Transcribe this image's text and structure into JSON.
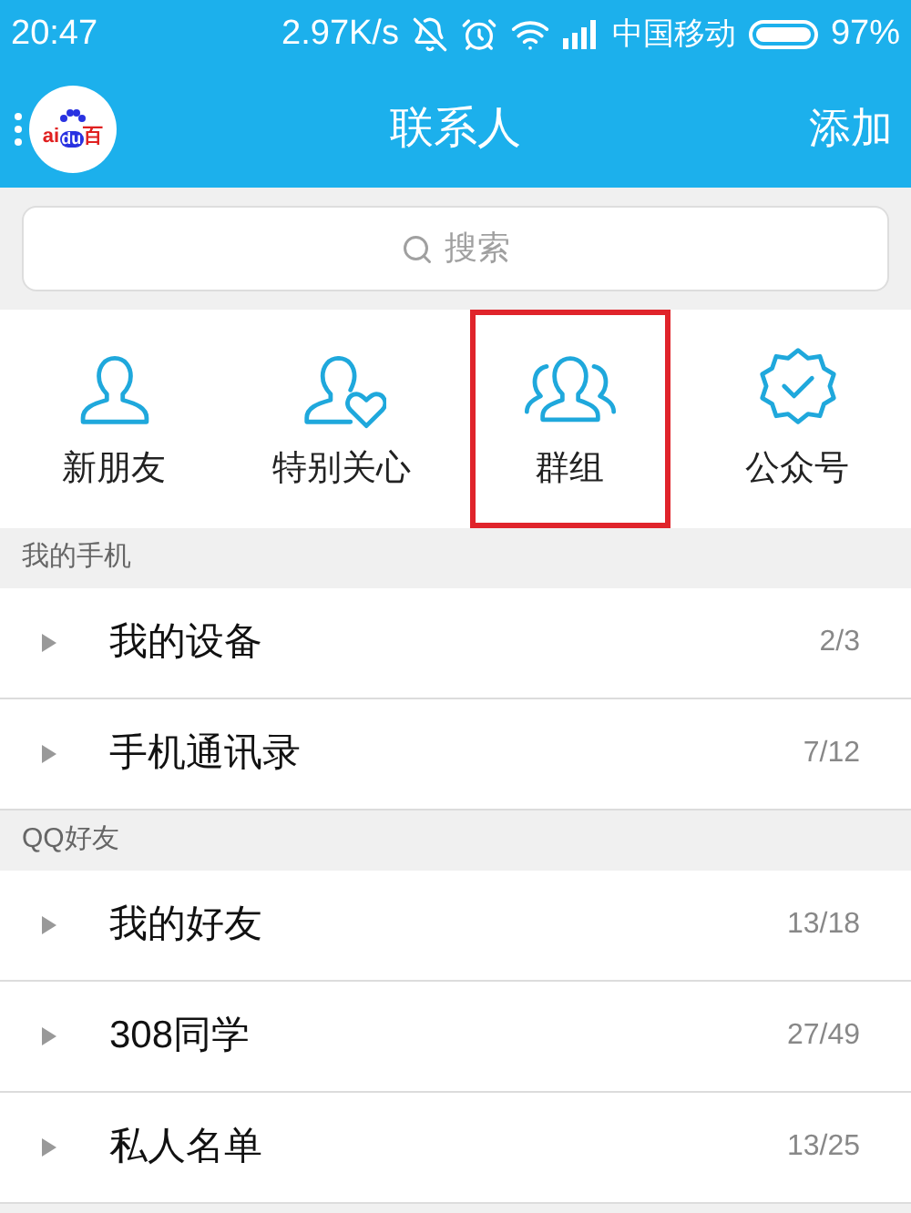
{
  "status_bar": {
    "time": "20:47",
    "speed": "2.97K/s",
    "carrier": "中国移动",
    "battery": "97%"
  },
  "header": {
    "logo_text": [
      "ai",
      "du",
      "百"
    ],
    "title": "联系人",
    "action": "添加"
  },
  "search": {
    "placeholder": "搜索"
  },
  "shortcuts": [
    {
      "kind": "person",
      "label": "新朋友",
      "highlighted": false
    },
    {
      "kind": "favorite",
      "label": "特别关心",
      "highlighted": false
    },
    {
      "kind": "group",
      "label": "群组",
      "highlighted": true
    },
    {
      "kind": "official",
      "label": "公众号",
      "highlighted": false
    }
  ],
  "sections": [
    {
      "title": "我的手机",
      "rows": [
        {
          "name": "我的设备",
          "count": "2/3",
          "expanded": false
        },
        {
          "name": "手机通讯录",
          "count": "7/12",
          "expanded": false
        }
      ]
    },
    {
      "title": "QQ好友",
      "rows": [
        {
          "name": "我的好友",
          "count": "13/18",
          "expanded": false
        },
        {
          "name": "308同学",
          "count": "27/49",
          "expanded": false
        },
        {
          "name": "私人名单",
          "count": "13/25",
          "expanded": false
        }
      ]
    }
  ]
}
